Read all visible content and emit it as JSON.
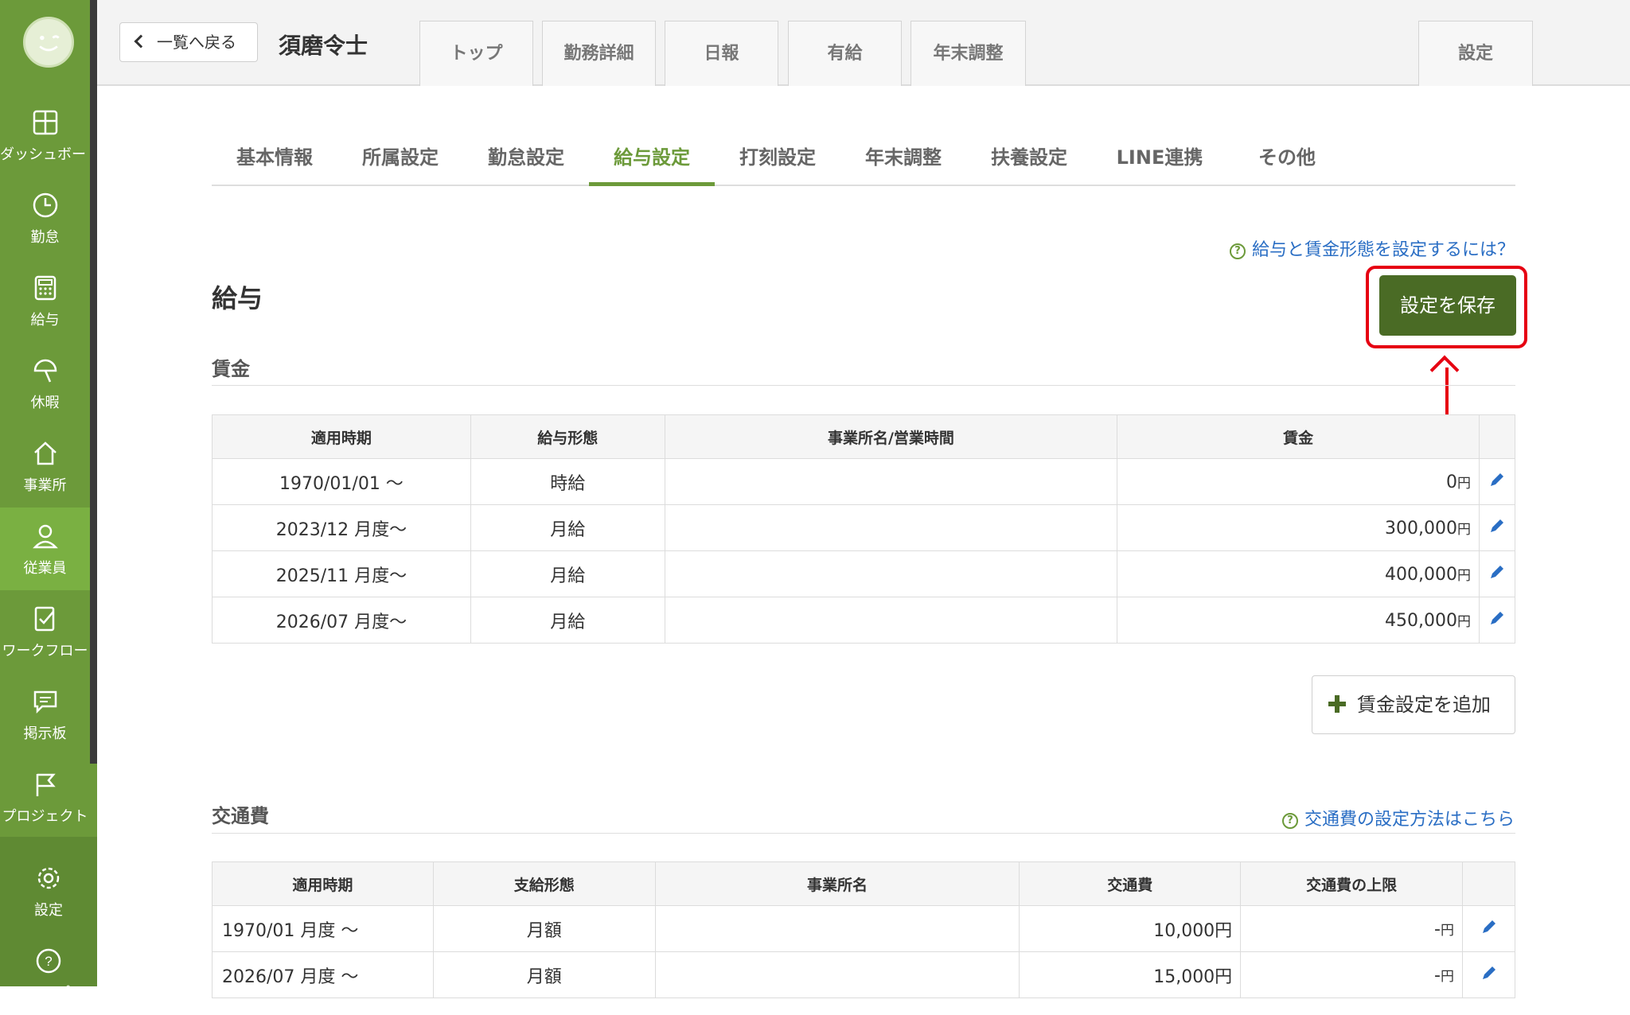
{
  "colors": {
    "brand": "#6c9a3a",
    "save": "#4a6b25",
    "highlight": "#e60012",
    "link": "#2a6ec4"
  },
  "sidebar": {
    "items": [
      {
        "label": "ダッシュボード",
        "icon": "dashboard-icon"
      },
      {
        "label": "勤怠",
        "icon": "clock-icon"
      },
      {
        "label": "給与",
        "icon": "calculator-icon"
      },
      {
        "label": "休暇",
        "icon": "parasol-icon"
      },
      {
        "label": "事業所",
        "icon": "home-icon"
      },
      {
        "label": "従業員",
        "icon": "person-icon",
        "active": true
      },
      {
        "label": "ワークフロー",
        "icon": "workflow-icon"
      },
      {
        "label": "掲示板",
        "icon": "chat-icon"
      },
      {
        "label": "プロジェクト",
        "icon": "flag-icon"
      },
      {
        "label": "設定",
        "icon": "gear-icon"
      },
      {
        "label": "ヘルプ",
        "icon": "help-icon"
      }
    ]
  },
  "header": {
    "back_label": "一覧へ戻る",
    "employee_name": "須磨令士",
    "tabs": [
      "トップ",
      "勤務詳細",
      "日報",
      "有給",
      "年末調整"
    ],
    "settings_tab": "設定"
  },
  "subtabs": {
    "items": [
      "基本情報",
      "所属設定",
      "勤怠設定",
      "給与設定",
      "打刻設定",
      "年末調整",
      "扶養設定",
      "LINE連携",
      "その他"
    ],
    "active": "給与設定"
  },
  "salary": {
    "help_link": "給与と賃金形態を設定するには？",
    "title": "給与",
    "save_label": "設定を保存",
    "wage_section": "賃金",
    "wage_headers": [
      "適用時期",
      "給与形態",
      "事業所名/営業時間",
      "賃金"
    ],
    "wage_rows": [
      {
        "period": "1970/01/01 〜",
        "type": "時給",
        "office": "",
        "amount": "0",
        "unit": "円"
      },
      {
        "period": "2023/12 月度〜",
        "type": "月給",
        "office": "",
        "amount": "300,000",
        "unit": "円"
      },
      {
        "period": "2025/11 月度〜",
        "type": "月給",
        "office": "",
        "amount": "400,000",
        "unit": "円"
      },
      {
        "period": "2026/07 月度〜",
        "type": "月給",
        "office": "",
        "amount": "450,000",
        "unit": "円"
      }
    ],
    "add_wage_label": "賃金設定を追加"
  },
  "transport": {
    "section": "交通費",
    "help_link": "交通費の設定方法はこちら",
    "headers": [
      "適用時期",
      "支給形態",
      "事業所名",
      "交通費",
      "交通費の上限"
    ],
    "rows": [
      {
        "period": "1970/01 月度 〜",
        "type": "月額",
        "office": "",
        "amount": "10,000円",
        "limit": "-",
        "limit_unit": "円"
      },
      {
        "period": "2026/07 月度 〜",
        "type": "月額",
        "office": "",
        "amount": "15,000円",
        "limit": "-",
        "limit_unit": "円"
      }
    ]
  }
}
